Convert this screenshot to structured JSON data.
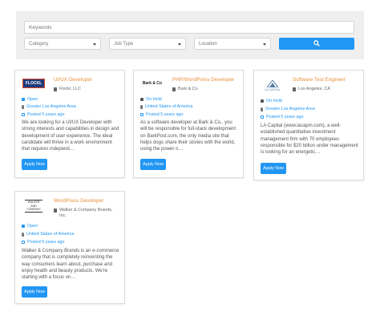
{
  "search": {
    "keywords_placeholder": "Keywords",
    "category_label": "Category",
    "job_type_label": "Job Type",
    "location_label": "Location"
  },
  "jobs": [
    {
      "title": "UI/UX Developer",
      "company": "Flockl, LLC",
      "logo_text": "FLOCKL",
      "status": "Open",
      "location": "Greater Los Angeles Area",
      "posted": "Posted 5 years ago",
      "description": "We are looking for a UI/UX Developer with strong interests and capabilities in design and development of user experience. The ideal candidate will thrive in a work environment that requires independ…",
      "apply_label": "Apply Now"
    },
    {
      "title": "PHP/WordPress Developer",
      "company": "Bark & Co",
      "logo_text": "Bark & Co",
      "status": "On Hold",
      "location": "United States of America",
      "posted": "Posted 5 years ago",
      "description": "As a software developer at Bark & Co., you will be responsible for full-stack development on BarkPost.com, the only media site that helps dogs share their stories with the world, using the power o…",
      "apply_label": "Apply Now"
    },
    {
      "title": "Software Test Engineer",
      "company": "Los Angeles, CA",
      "logo_text": "LA CAPITAL",
      "status": "On Hold",
      "location": "Greater Los Angeles Area",
      "posted": "Posted 5 years ago",
      "description": "LA Capital (www.lacapm.com), a well-established quantitative investment management firm with 70 employees responsible for $20 billion under management is looking for an energetic…",
      "apply_label": "Apply Now"
    },
    {
      "title": "WordPress Developer",
      "company": "Walker & Company Brands, Inc.",
      "logo_text": "WALKER AND COMPANY",
      "status": "Open",
      "location": "United States of America",
      "posted": "Posted 5 years ago",
      "description": "Walker & Company Brands is an e-commerce company that is completely reinventing the way consumers learn about, purchase and enjoy health and beauty products. We're starting with a focus on…",
      "apply_label": "Apply Now"
    }
  ],
  "colors": {
    "accent": "#2196f3",
    "title": "#e8903a",
    "status_open": "#2196f3",
    "status_hold": "#2196f3"
  }
}
